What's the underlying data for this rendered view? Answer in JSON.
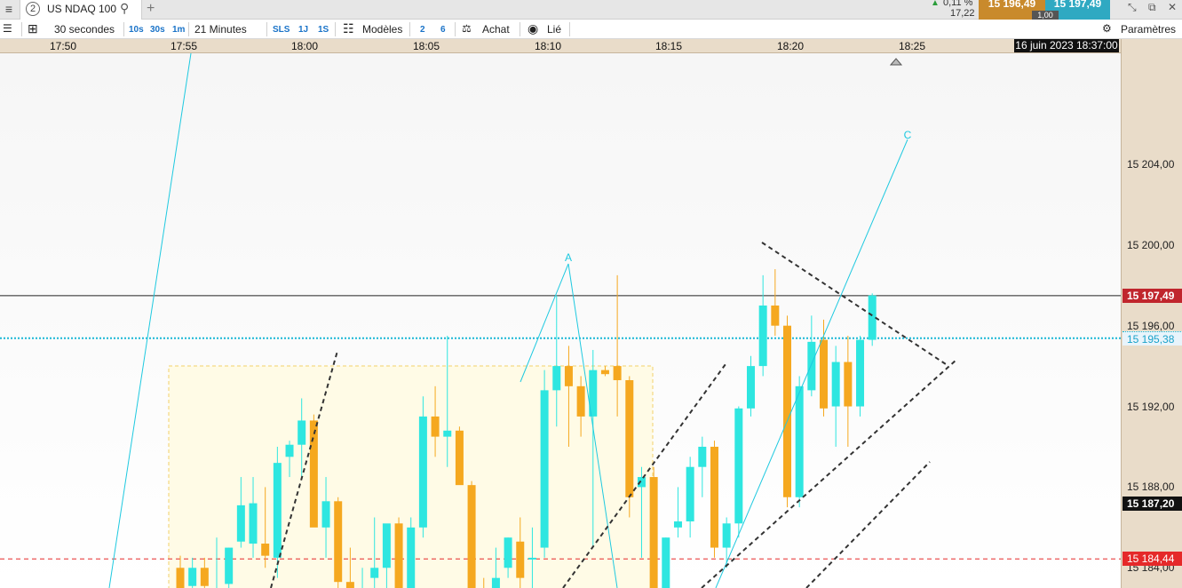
{
  "header": {
    "menu_icon": "hamburger-icon",
    "tab": {
      "number": "2",
      "title": "US NDAQ 100",
      "search_icon": "search-icon"
    },
    "add_tab": "+",
    "change_pct": "0,11 %",
    "change_abs": "17,22",
    "sell_price": "15 196,49",
    "buy_price": "15 197,49",
    "spread": "1,00"
  },
  "toolbar": {
    "timeframe": "30 secondes",
    "intervals": [
      "10s",
      "30s",
      "1m"
    ],
    "duration": "21 Minutes",
    "buttons_small": [
      "SLS",
      "1J",
      "1S"
    ],
    "models_label": "Modèles",
    "counts": [
      "2",
      "6"
    ],
    "buy_label": "Achat",
    "link_label": "Lié",
    "settings_label": "Paramètres"
  },
  "colors": {
    "up_candle": "#2ee6e0",
    "down_candle": "#f5a81f",
    "current_price": "#c0262d",
    "ref_line": "#1ab7d6",
    "support_line": "#e52929",
    "trend_line": "#1ec9e0",
    "zone_fill": "#fffbe6"
  },
  "chart_data": {
    "type": "candlestick",
    "instrument": "US NDAQ 100",
    "date_label": "16 juin 2023 18:37:00",
    "x_ticks": [
      "17:50",
      "17:55",
      "18:00",
      "18:05",
      "18:10",
      "18:15",
      "18:20",
      "18:25"
    ],
    "y_ticks": [
      15184,
      15188,
      15192,
      15196,
      15200,
      15204
    ],
    "y_tick_labels": [
      "15 184,00",
      "15 188,00",
      "15 192,00",
      "15 196,00",
      "15 200,00",
      "15 204,00"
    ],
    "ylim": [
      15183.0,
      15209.5
    ],
    "price_labels": {
      "current": {
        "value": 15197.49,
        "text": "15 197,49"
      },
      "reference": {
        "value": 15195.38,
        "text": "15 195,38"
      },
      "low": {
        "value": 15187.2,
        "text": "15 187,20"
      },
      "support": {
        "value": 15184.44,
        "text": "15 184,44"
      }
    },
    "wave_labels": [
      "A",
      "C"
    ],
    "candles": [
      {
        "t": "17:56",
        "o": 15184.0,
        "h": 15184.6,
        "l": 15182.5,
        "c": 15183.0
      },
      {
        "t": "17:56:30",
        "o": 15183.1,
        "h": 15184.5,
        "l": 15182.5,
        "c": 15184.0
      },
      {
        "t": "17:57",
        "o": 15184.0,
        "h": 15184.5,
        "l": 15182.0,
        "c": 15183.1
      },
      {
        "t": "17:57:30",
        "o": 15183.0,
        "h": 15185.5,
        "l": 15182.0,
        "c": 15183.0
      },
      {
        "t": "17:58",
        "o": 15183.2,
        "h": 15185.0,
        "l": 15182.5,
        "c": 15185.0
      },
      {
        "t": "17:58:30",
        "o": 15185.3,
        "h": 15188.5,
        "l": 15185.0,
        "c": 15187.1
      },
      {
        "t": "17:59",
        "o": 15185.2,
        "h": 15188.5,
        "l": 15184.5,
        "c": 15187.2
      },
      {
        "t": "17:59:30",
        "o": 15185.2,
        "h": 15188.0,
        "l": 15184.0,
        "c": 15184.6
      },
      {
        "t": "18:00",
        "o": 15184.5,
        "h": 15190.0,
        "l": 15183.5,
        "c": 15189.2
      },
      {
        "t": "18:00:30",
        "o": 15189.5,
        "h": 15190.3,
        "l": 15188.5,
        "c": 15190.1
      },
      {
        "t": "18:01",
        "o": 15190.1,
        "h": 15192.4,
        "l": 15188.5,
        "c": 15191.3
      },
      {
        "t": "18:01:30",
        "o": 15191.3,
        "h": 15191.6,
        "l": 15187.5,
        "c": 15186.0
      },
      {
        "t": "18:02",
        "o": 15186.0,
        "h": 15188.5,
        "l": 15184.5,
        "c": 15187.3
      },
      {
        "t": "18:02:30",
        "o": 15187.3,
        "h": 15187.5,
        "l": 15182.0,
        "c": 15183.3
      },
      {
        "t": "18:03",
        "o": 15183.3,
        "h": 15185.0,
        "l": 15182.0,
        "c": 15182.5
      },
      {
        "t": "18:03:30",
        "o": 15182.5,
        "h": 15184.0,
        "l": 15182.0,
        "c": 15183.0
      },
      {
        "t": "18:04",
        "o": 15183.5,
        "h": 15186.5,
        "l": 15182.5,
        "c": 15184.0
      },
      {
        "t": "18:04:30",
        "o": 15184.0,
        "h": 15186.0,
        "l": 15183.0,
        "c": 15186.2
      },
      {
        "t": "18:05",
        "o": 15186.2,
        "h": 15186.5,
        "l": 15182.5,
        "c": 15183.0
      },
      {
        "t": "18:05:30",
        "o": 15183.0,
        "h": 15186.5,
        "l": 15182.5,
        "c": 15186.0
      },
      {
        "t": "18:06",
        "o": 15186.0,
        "h": 15192.5,
        "l": 15185.5,
        "c": 15191.5
      },
      {
        "t": "18:06:30",
        "o": 15191.5,
        "h": 15193.0,
        "l": 15189.5,
        "c": 15190.5
      },
      {
        "t": "18:07",
        "o": 15190.5,
        "h": 15195.5,
        "l": 15189.0,
        "c": 15190.8
      },
      {
        "t": "18:07:30",
        "o": 15190.8,
        "h": 15191.0,
        "l": 15188.5,
        "c": 15188.1
      },
      {
        "t": "18:08",
        "o": 15188.1,
        "h": 15188.3,
        "l": 15182.0,
        "c": 15183.0
      },
      {
        "t": "18:08:30",
        "o": 15183.0,
        "h": 15183.5,
        "l": 15182.0,
        "c": 15182.5
      },
      {
        "t": "18:09",
        "o": 15183.0,
        "h": 15185.0,
        "l": 15182.0,
        "c": 15183.5
      },
      {
        "t": "18:09:30",
        "o": 15184.0,
        "h": 15185.5,
        "l": 15183.5,
        "c": 15185.5
      },
      {
        "t": "18:10",
        "o": 15185.3,
        "h": 15186.5,
        "l": 15183.0,
        "c": 15183.5
      },
      {
        "t": "18:10:30",
        "o": 15184.5,
        "h": 15186.0,
        "l": 15183.0,
        "c": 15184.5
      },
      {
        "t": "18:11",
        "o": 15185.0,
        "h": 15193.8,
        "l": 15184.5,
        "c": 15192.8
      },
      {
        "t": "18:11:30",
        "o": 15192.8,
        "h": 15197.5,
        "l": 15191.0,
        "c": 15194.0
      },
      {
        "t": "18:12",
        "o": 15194.0,
        "h": 15195.0,
        "l": 15190.0,
        "c": 15193.0
      },
      {
        "t": "18:12:30",
        "o": 15193.0,
        "h": 15193.5,
        "l": 15190.5,
        "c": 15191.5
      },
      {
        "t": "18:13",
        "o": 15191.5,
        "h": 15194.8,
        "l": 15185.0,
        "c": 15193.8
      },
      {
        "t": "18:13:30",
        "o": 15193.8,
        "h": 15194.0,
        "l": 15193.5,
        "c": 15193.6
      },
      {
        "t": "18:14",
        "o": 15194.0,
        "h": 15198.5,
        "l": 15191.5,
        "c": 15193.3
      },
      {
        "t": "18:14:30",
        "o": 15193.3,
        "h": 15193.5,
        "l": 15186.5,
        "c": 15187.5
      },
      {
        "t": "18:15",
        "o": 15188.0,
        "h": 15189.0,
        "l": 15184.5,
        "c": 15188.5
      },
      {
        "t": "18:15:30",
        "o": 15188.5,
        "h": 15189.0,
        "l": 15182.0,
        "c": 15183.0
      },
      {
        "t": "18:16",
        "o": 15183.0,
        "h": 15185.5,
        "l": 15182.0,
        "c": 15185.5
      },
      {
        "t": "18:16:30",
        "o": 15186.0,
        "h": 15188.0,
        "l": 15185.5,
        "c": 15186.3
      },
      {
        "t": "18:17",
        "o": 15186.3,
        "h": 15189.5,
        "l": 15185.5,
        "c": 15189.0
      },
      {
        "t": "18:17:30",
        "o": 15189.0,
        "h": 15190.5,
        "l": 15187.5,
        "c": 15190.0
      },
      {
        "t": "18:18",
        "o": 15190.0,
        "h": 15190.3,
        "l": 15184.5,
        "c": 15185.0
      },
      {
        "t": "18:18:30",
        "o": 15185.0,
        "h": 15186.5,
        "l": 15184.0,
        "c": 15186.2
      },
      {
        "t": "18:19",
        "o": 15186.2,
        "h": 15192.0,
        "l": 15185.5,
        "c": 15191.9
      },
      {
        "t": "18:19:30",
        "o": 15191.9,
        "h": 15194.5,
        "l": 15191.5,
        "c": 15194.0
      },
      {
        "t": "18:20",
        "o": 15194.0,
        "h": 15198.5,
        "l": 15193.5,
        "c": 15197.0
      },
      {
        "t": "18:20:30",
        "o": 15197.0,
        "h": 15198.8,
        "l": 15195.5,
        "c": 15196.0
      },
      {
        "t": "18:21",
        "o": 15196.0,
        "h": 15196.5,
        "l": 15187.0,
        "c": 15187.5
      },
      {
        "t": "18:21:30",
        "o": 15187.5,
        "h": 15193.5,
        "l": 15187.0,
        "c": 15193.0
      },
      {
        "t": "18:22",
        "o": 15192.8,
        "h": 15196.5,
        "l": 15192.5,
        "c": 15195.2
      },
      {
        "t": "18:22:30",
        "o": 15195.3,
        "h": 15196.3,
        "l": 15191.5,
        "c": 15191.9
      },
      {
        "t": "18:23",
        "o": 15192.0,
        "h": 15195.0,
        "l": 15190.0,
        "c": 15194.2
      },
      {
        "t": "18:23:30",
        "o": 15194.2,
        "h": 15195.5,
        "l": 15190.0,
        "c": 15192.0
      },
      {
        "t": "18:24",
        "o": 15192.0,
        "h": 15195.5,
        "l": 15191.5,
        "c": 15195.3
      },
      {
        "t": "18:24:30",
        "o": 15195.3,
        "h": 15197.6,
        "l": 15195.0,
        "c": 15197.5
      }
    ]
  }
}
